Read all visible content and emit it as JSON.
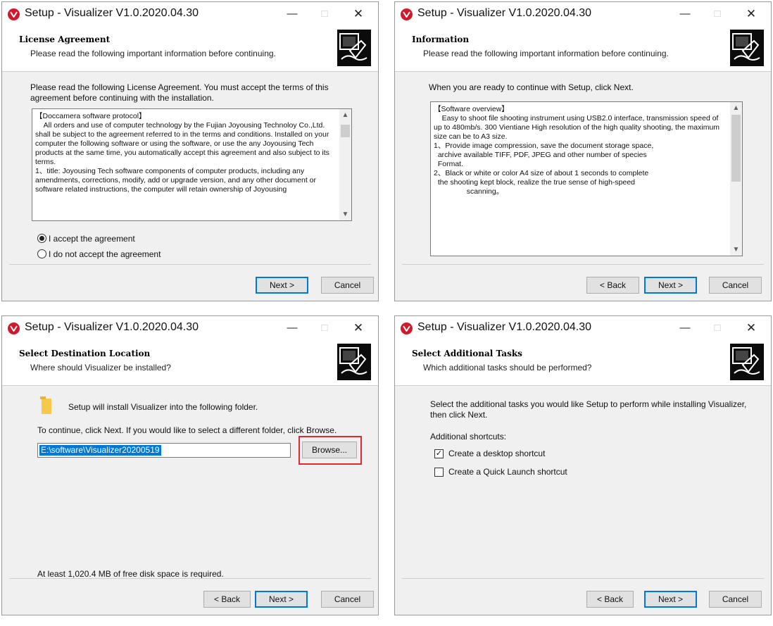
{
  "window_title": "Setup - Visualizer V1.0.2020.04.30",
  "titlebar": {
    "minimize": "—",
    "maximize": "□",
    "close": "✕"
  },
  "buttons": {
    "back": "< Back",
    "next": "Next >",
    "cancel": "Cancel",
    "browse": "Browse..."
  },
  "license": {
    "title": "License Agreement",
    "subtitle": "Please read the following important information before continuing.",
    "intro": "Please read the following License Agreement. You must accept the terms of this agreement before continuing with the installation.",
    "memo_lines": [
      "【Doccamera software protocol】",
      "",
      "    All orders and use of computer technology by the Fujian Joyousing Technoloy Co.,Ltd. shall be subject to the agreement referred to in the terms and conditions. Installed on your computer the following software or using the software, or use the any Joyousing Tech products at the same time, you automatically accept this agreement and also subject to its terms.",
      "",
      "1、title: Joyousing Tech software components of computer products, including any amendments, corrections, modify, add or upgrade version, and any other document or software related instructions, the computer will retain ownership of Joyousing"
    ],
    "accept": "I accept the agreement",
    "decline": "I do not accept the agreement"
  },
  "information": {
    "title": "Information",
    "subtitle": "Please read the following important information before continuing.",
    "intro": "When you are ready to continue with Setup, click Next.",
    "memo_lines": [
      "【Software overview】",
      "",
      "    Easy to shoot file shooting instrument using USB2.0 interface, transmission speed of up to 480mb/s. 300 Vientiane High resolution of the high quality shooting, the maximum size can be to A3 size.",
      "",
      "1、Provide image compression, save the document storage space,",
      "  archive available TIFF, PDF, JPEG and other number of species",
      "  Format.",
      "",
      "2、Black or white or color A4 size of about 1 seconds to complete",
      "  the shooting kept block, realize the true sense of high-speed",
      "                scanning。"
    ]
  },
  "destination": {
    "title": "Select Destination Location",
    "subtitle": "Where should Visualizer be installed?",
    "folder_text": "Setup will install Visualizer into the following folder.",
    "continue_text": "To continue, click Next. If you would like to select a different folder, click Browse.",
    "path": "E:\\software\\Visualizer20200519",
    "space_text": "At least 1,020.4 MB of free disk space is required."
  },
  "tasks": {
    "title": "Select Additional Tasks",
    "subtitle": "Which additional tasks should be performed?",
    "intro": "Select the additional tasks you would like Setup to perform while installing Visualizer, then click Next.",
    "shortcuts_label": "Additional shortcuts:",
    "desktop_shortcut": "Create a desktop shortcut",
    "desktop_checked": true,
    "quicklaunch_shortcut": "Create a Quick Launch shortcut",
    "quicklaunch_checked": false
  },
  "icons": [
    "app-icon",
    "setup-logo-icon",
    "folder-icon",
    "scroll-up-icon",
    "scroll-down-icon"
  ],
  "colors": {
    "accent": "#0078d7",
    "highlight": "#e0282e",
    "app_icon": "#d0192b"
  }
}
